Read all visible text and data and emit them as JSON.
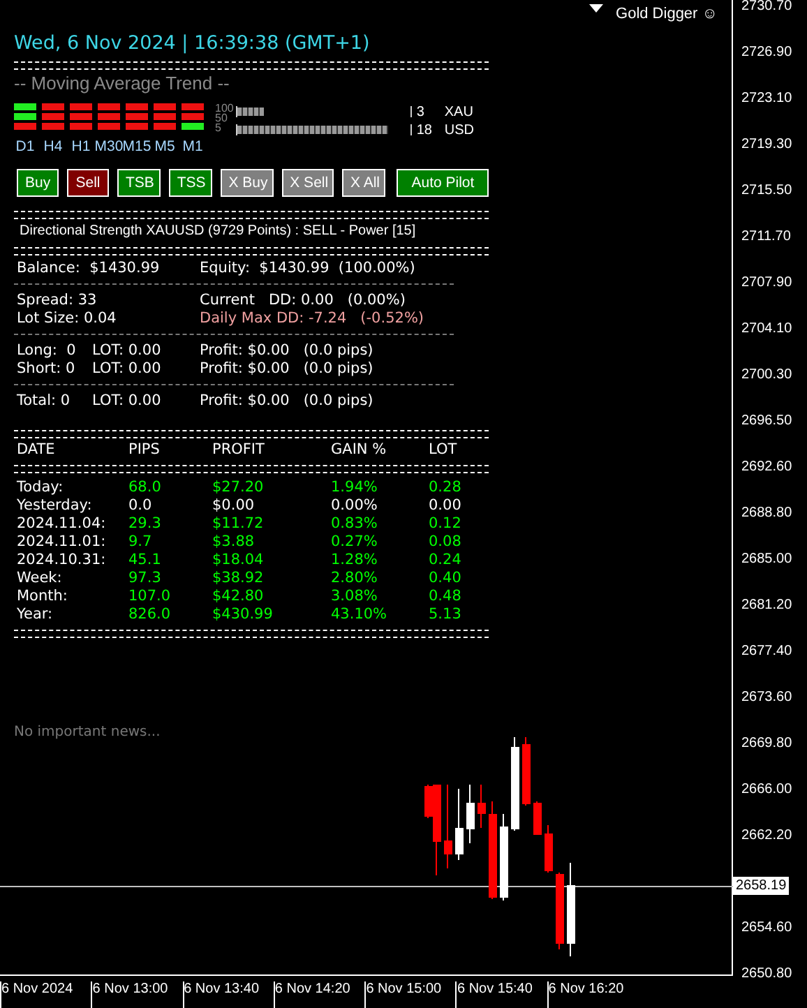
{
  "header": {
    "datetime": "Wed, 6 Nov 2024 | 16:39:38 (GMT+1)",
    "ea_name": "Gold Digger ☺"
  },
  "trend": {
    "title": "-- Moving Average Trend --",
    "timeframes": [
      {
        "label": "D1",
        "signals": [
          true,
          true,
          false
        ]
      },
      {
        "label": "H4",
        "signals": [
          false,
          false,
          false
        ]
      },
      {
        "label": "H1",
        "signals": [
          false,
          false,
          false
        ]
      },
      {
        "label": "M30",
        "signals": [
          false,
          false,
          false
        ]
      },
      {
        "label": "M15",
        "signals": [
          false,
          false,
          false
        ]
      },
      {
        "label": "M5",
        "signals": [
          false,
          false,
          false
        ]
      },
      {
        "label": "M1",
        "signals": [
          false,
          false,
          true
        ]
      }
    ],
    "scale_labels": [
      "100",
      "50",
      "5"
    ],
    "meters": [
      {
        "level": 0.15,
        "value": "3",
        "currency": "XAU"
      },
      {
        "level": 0.87,
        "value": "18",
        "currency": "USD"
      }
    ]
  },
  "buttons": [
    {
      "label": "Buy",
      "color": "#008000"
    },
    {
      "label": "Sell",
      "color": "#800000"
    },
    {
      "label": "TSB",
      "color": "#008000"
    },
    {
      "label": "TSS",
      "color": "#008000"
    },
    {
      "label": "X Buy",
      "color": "#808080"
    },
    {
      "label": "X Sell",
      "color": "#808080"
    },
    {
      "label": "X All",
      "color": "#808080"
    },
    {
      "label": "Auto Pilot",
      "color": "#008000"
    }
  ],
  "strength": "Directional Strength XAUUSD (9729 Points) : SELL - Power [15]",
  "stats": [
    [
      {
        "kind": "normal",
        "a": "Balance:  $1430.99",
        "c": "Equity:  $1430.99  (100.00%)"
      }
    ],
    [
      {
        "kind": "normal",
        "a": "Spread: 33",
        "c": "Current   DD: 0.00   (0.00%)"
      },
      {
        "kind": "alert",
        "a": "Lot Size: 0.04",
        "c": "Daily Max DD: -7.24   (-0.52%)"
      }
    ],
    [
      {
        "kind": "normal",
        "a": "Long:  0",
        "b": "LOT: 0.00",
        "c": "Profit: $0.00   (0.0 pips)"
      },
      {
        "kind": "normal",
        "a": "Short: 0",
        "b": "LOT: 0.00",
        "c": "Profit: $0.00   (0.0 pips)"
      }
    ],
    [
      {
        "kind": "normal",
        "a": "Total: 0",
        "b": "LOT: 0.00",
        "c": "Profit: $0.00   (0.0 pips)"
      }
    ]
  ],
  "history": {
    "columns": [
      "DATE",
      "PIPS",
      "PROFIT",
      "GAIN %",
      "LOT"
    ],
    "rows": [
      {
        "color": "#00ff00",
        "cells": [
          "Today:",
          "68.0",
          "$27.20",
          "1.94%",
          "0.28"
        ]
      },
      {
        "color": "#ffffff",
        "cells": [
          "Yesterday:",
          "0.0",
          "$0.00",
          "0.00%",
          "0.00"
        ]
      },
      {
        "color": "#00ff00",
        "cells": [
          "2024.11.04:",
          "29.3",
          "$11.72",
          "0.83%",
          "0.12"
        ]
      },
      {
        "color": "#00ff00",
        "cells": [
          "2024.11.01:",
          "9.7",
          "$3.88",
          "0.27%",
          "0.08"
        ]
      },
      {
        "color": "#00ff00",
        "cells": [
          "2024.10.31:",
          "45.1",
          "$18.04",
          "1.28%",
          "0.24"
        ]
      },
      {
        "color": "#00ff00",
        "cells": [
          "Week:",
          "97.3",
          "$38.92",
          "2.80%",
          "0.40"
        ]
      },
      {
        "color": "#00ff00",
        "cells": [
          "Month:",
          "107.0",
          "$42.80",
          "3.08%",
          "0.48"
        ]
      },
      {
        "color": "#00ff00",
        "cells": [
          "Year:",
          "826.0",
          "$430.99",
          "43.10%",
          "5.13"
        ]
      }
    ]
  },
  "news": "No important news...",
  "price_axis": {
    "ticks": [
      "2730.70",
      "2726.90",
      "2723.10",
      "2719.30",
      "2715.50",
      "2711.70",
      "2707.90",
      "2704.10",
      "2700.30",
      "2696.50",
      "2692.60",
      "2688.80",
      "2685.00",
      "2681.20",
      "2677.40",
      "2673.60",
      "2669.80",
      "2666.00",
      "2662.20",
      "2654.60",
      "2650.80"
    ],
    "current_price": "2658.19"
  },
  "time_axis": [
    "6 Nov 2024",
    "6 Nov 13:00",
    "6 Nov 13:40",
    "6 Nov 14:20",
    "6 Nov 15:00",
    "6 Nov 15:40",
    "6 Nov 16:20"
  ]
}
